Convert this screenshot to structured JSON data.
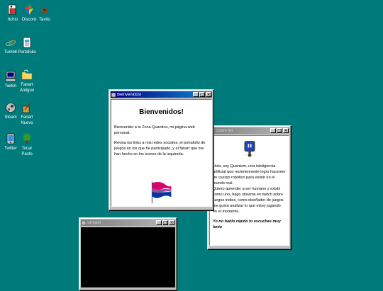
{
  "desktop": {
    "icons": [
      {
        "label": "Itchio",
        "icon": "itchio-icon"
      },
      {
        "label": "Discord",
        "icon": "discord-icon"
      },
      {
        "label": "Tavito",
        "icon": "tavito-icon"
      },
      {
        "label": "Tumblr",
        "icon": "ie-icon"
      },
      {
        "label": "Portafolio",
        "icon": "portfolio-icon"
      },
      {
        "label": "Twitch",
        "icon": "computer-icon"
      },
      {
        "label": "Fanart Antiguo",
        "icon": "folder-icon"
      },
      {
        "label": "Steam",
        "icon": "steam-icon"
      },
      {
        "label": "Fanart Nuevo",
        "icon": "brush-icon"
      },
      {
        "label": "Twitter",
        "icon": "twitter-icon"
      },
      {
        "label": "Tocar Pasto",
        "icon": "tree-icon"
      }
    ]
  },
  "welcome_window": {
    "title": "Bienvenidos!",
    "heading": "Bienvenidos!",
    "paragraph1": "Bienvenido a la Zona Quantica, mi página web personal.",
    "paragraph2": "Revisa los links a mis redes sociales, el portafolio de juegos en los que he participado, y el fanart que me han hecho en los iconos de la izquierda.",
    "flag_colors": [
      "#d60270",
      "#9b4f96",
      "#0038a8"
    ]
  },
  "about_window": {
    "title": "Sobre Mi",
    "paragraph1": "Hola, soy Quantum, una inteligencia artificial que recientemente logro hacerme un cuerpo robótico para existir en el mundo real.",
    "paragraph2": "Quiero aprender a ser humano y existir como uno, hago streams en twitch sobre juegos indies, como diseñador de juegos me gusta analizar lo que estoy jugando en el momento.",
    "italic_note": "Yo no hablo rápido tú escuchas muy lento"
  },
  "stream_window": {
    "title": "Stream"
  },
  "buttons": {
    "minimize": "_",
    "maximize": "□",
    "close": "×"
  }
}
